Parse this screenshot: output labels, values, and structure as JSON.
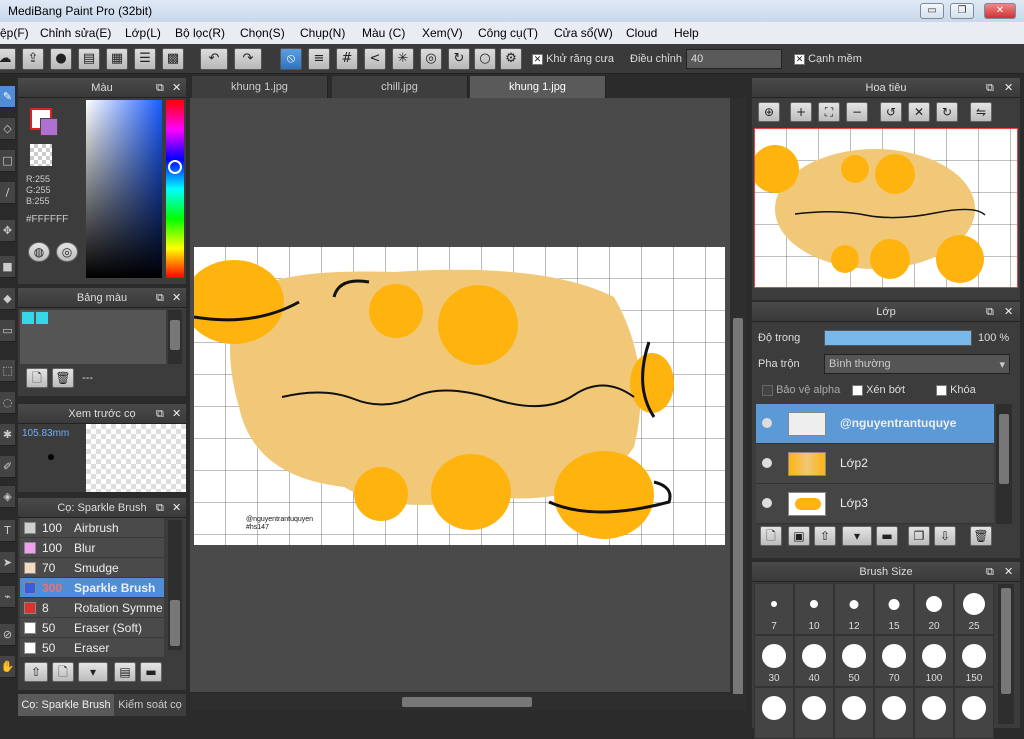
{
  "app": {
    "title": "MediBang Paint Pro (32bit)",
    "minimize": "▭",
    "restore": "❐",
    "close": "✕"
  },
  "menu": [
    "ệp(F)",
    "Chỉnh sửa(E)",
    "Lớp(L)",
    "Bộ lọc(R)",
    "Chọn(S)",
    "Chụp(N)",
    "Màu (C)",
    "Xem(V)",
    "Công cụ(T)",
    "Cửa sổ(W)",
    "Cloud",
    "Help"
  ],
  "toolbar": {
    "antialias_label": "Khử răng cưa",
    "adjust_label": "Điều chỉnh",
    "adjust_value": "40",
    "softedge_label": "Cạnh mềm"
  },
  "color_panel": {
    "title": "Màu",
    "r": "R:255",
    "g": "G:255",
    "b": "B:255",
    "hex": "#FFFFFF"
  },
  "palette_panel": {
    "title": "Bảng màu",
    "value": "---"
  },
  "brush_preview": {
    "title": "Xem trước cọ",
    "size": "105.83mm"
  },
  "brush_panel": {
    "title": "Cọ: Sparkle Brush",
    "items": [
      {
        "size": "100",
        "name": "Airbrush",
        "color": "#cfcfcf"
      },
      {
        "size": "100",
        "name": "Blur",
        "color": "#f0a0f0"
      },
      {
        "size": "70",
        "name": "Smudge",
        "color": "#f5d8c0"
      },
      {
        "size": "300",
        "name": "Sparkle Brush",
        "color": "#3a5de0",
        "selected": true
      },
      {
        "size": "8",
        "name": "Rotation Symme",
        "color": "#e03030"
      },
      {
        "size": "50",
        "name": "Eraser (Soft)",
        "color": "#ffffff"
      },
      {
        "size": "50",
        "name": "Eraser",
        "color": "#ffffff"
      }
    ]
  },
  "bottom_tabs": [
    "Cọ: Sparkle Brush",
    "Kiểm soát cọ"
  ],
  "doc_tabs": [
    "khung 1.jpg",
    "chill.jpg",
    "khung 1.jpg"
  ],
  "canvas": {
    "signature": "@nguyentrantuquyen",
    "tag": "#hs147",
    "word": "hoc dir"
  },
  "navigator": {
    "title": "Hoa tiêu"
  },
  "layer_panel": {
    "title": "Lớp",
    "opacity_label": "Độ trong",
    "opacity_value": "100 %",
    "opacity_fraction": 1.0,
    "blend_label": "Pha trộn",
    "blend_value": "Bình thường",
    "protect_alpha": "Bảo vệ alpha",
    "clipping": "Xén bớt",
    "lock": "Khóa",
    "layers": [
      {
        "name": "@nguyentrantuquye"
      },
      {
        "name": "Lớp2"
      },
      {
        "name": "Lớp3"
      }
    ]
  },
  "brush_size_panel": {
    "title": "Brush Size",
    "sizes": [
      "7",
      "10",
      "12",
      "15",
      "20",
      "25",
      "30",
      "40",
      "50",
      "70",
      "100",
      "150",
      "",
      "",
      "",
      "",
      "",
      ""
    ]
  }
}
